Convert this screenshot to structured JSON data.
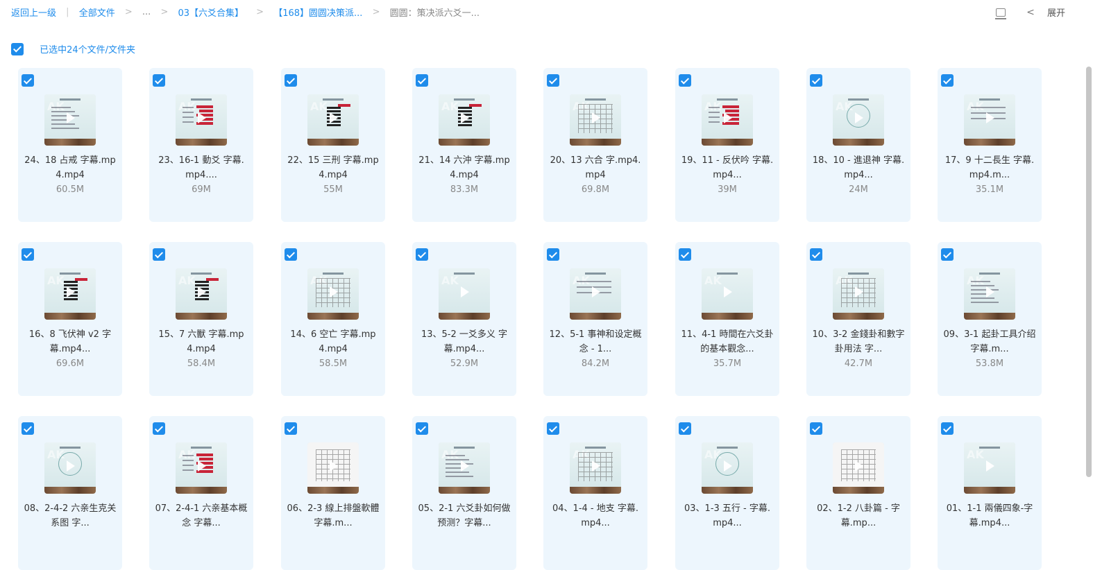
{
  "breadcrumb": {
    "back": "返回上一级",
    "all_files": "全部文件",
    "ellipsis": "...",
    "folder1": "03【六爻合集】",
    "folder2": "【168】圆圆决策派...",
    "current": "圆圆：策决派六爻一..."
  },
  "top_right": {
    "expand_label": "展开"
  },
  "selection": {
    "label": "已选中24个文件/文件夹"
  },
  "files": [
    {
      "name": "24、18 占戒 字幕.mp4.mp4",
      "size": "60.5M",
      "thumb": "list"
    },
    {
      "name": "23、16-1 動爻 字幕.mp4....",
      "size": "69M",
      "thumb": "red"
    },
    {
      "name": "22、15 三刑 字幕.mp4.mp4",
      "size": "55M",
      "thumb": "hex"
    },
    {
      "name": "21、14 六沖 字幕.mp4.mp4",
      "size": "83.3M",
      "thumb": "hex"
    },
    {
      "name": "20、13 六合 字.mp4.mp4",
      "size": "69.8M",
      "thumb": "table"
    },
    {
      "name": "19、11 - 反伏吟 字幕.mp4...",
      "size": "39M",
      "thumb": "red"
    },
    {
      "name": "18、10 - 進退神 字幕.mp4...",
      "size": "24M",
      "thumb": "circle"
    },
    {
      "name": "17、9 十二長生 字幕.mp4.m...",
      "size": "35.1M",
      "thumb": "play"
    },
    {
      "name": "16、8 飞伏神 v2 字幕.mp4...",
      "size": "69.6M",
      "thumb": "hex"
    },
    {
      "name": "15、7 六獸 字幕.mp4.mp4",
      "size": "58.4M",
      "thumb": "hex"
    },
    {
      "name": "14、6 空亡 字幕.mp4.mp4",
      "size": "58.5M",
      "thumb": "table"
    },
    {
      "name": "13、5-2 一爻多义 字幕.mp4...",
      "size": "52.9M",
      "thumb": "plain"
    },
    {
      "name": "12、5-1 事神和设定概念 - 1...",
      "size": "84.2M",
      "thumb": "play"
    },
    {
      "name": "11、4-1 時間在六爻卦的基本觀念...",
      "size": "35.7M",
      "thumb": "plain"
    },
    {
      "name": "10、3-2 金錢卦和數字卦用法 字...",
      "size": "42.7M",
      "thumb": "table"
    },
    {
      "name": "09、3-1 起卦工具介绍 字幕.m...",
      "size": "53.8M",
      "thumb": "list"
    },
    {
      "name": "08、2-4-2 六亲生克关系图 字...",
      "size": "",
      "thumb": "circle"
    },
    {
      "name": "07、2-4-1 六亲基本概念 字幕...",
      "size": "",
      "thumb": "red"
    },
    {
      "name": "06、2-3 線上排盤軟體 字幕.m...",
      "size": "",
      "thumb": "paper"
    },
    {
      "name": "05、2-1 六爻卦如何做预测？字幕...",
      "size": "",
      "thumb": "list"
    },
    {
      "name": "04、1-4 - 地支 字幕.mp4...",
      "size": "",
      "thumb": "table"
    },
    {
      "name": "03、1-3 五行 - 字幕.mp4...",
      "size": "",
      "thumb": "circle"
    },
    {
      "name": "02、1-2 八卦篇 - 字幕.mp...",
      "size": "",
      "thumb": "paper"
    },
    {
      "name": "01、1-1 兩儀四象-字幕.mp4...",
      "size": "",
      "thumb": "plain"
    }
  ],
  "colors": {
    "accent": "#1f8ceb",
    "card_bg": "#edf6fd"
  }
}
